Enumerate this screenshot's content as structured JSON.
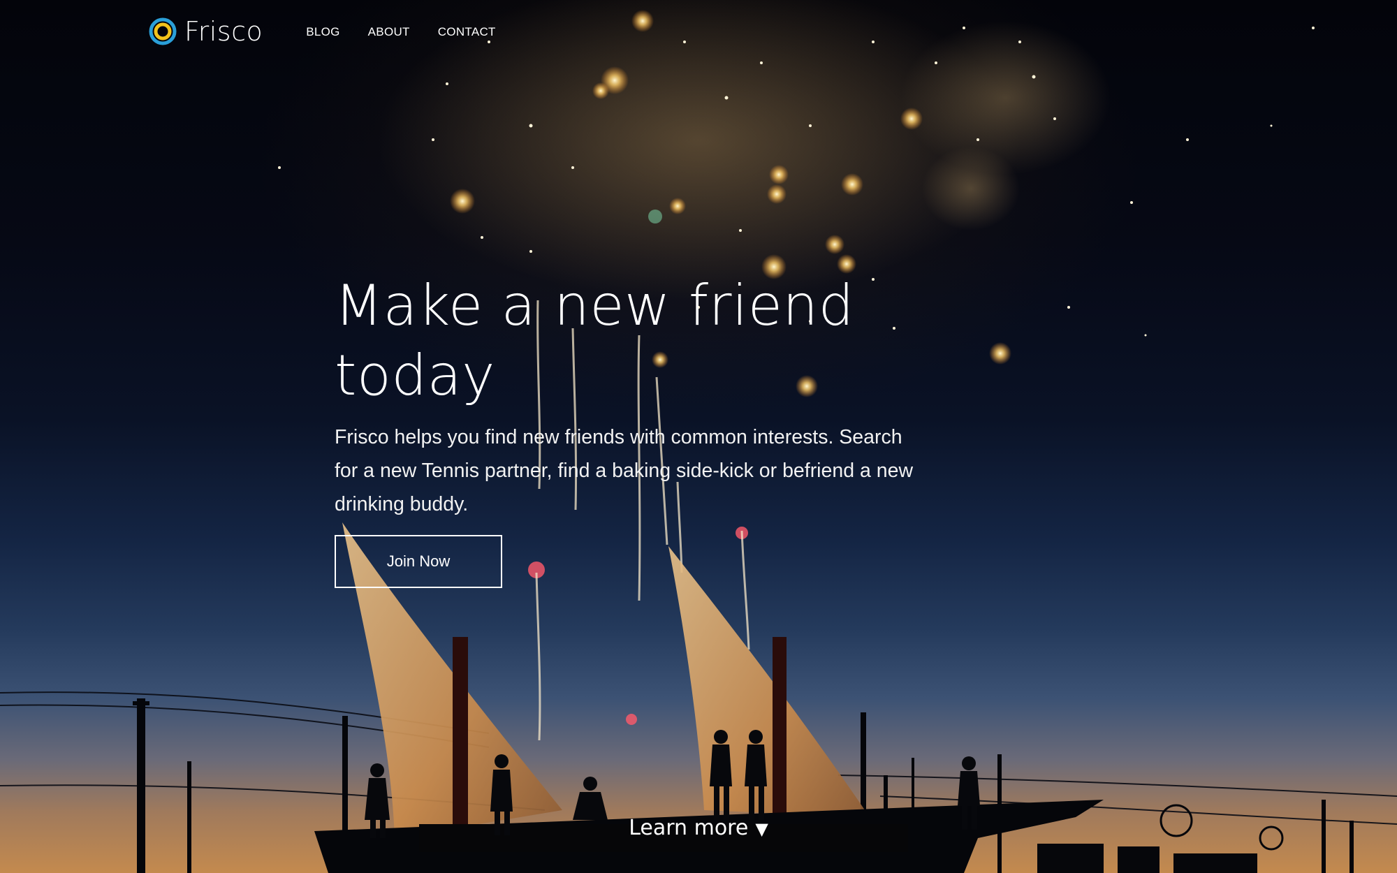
{
  "brand": {
    "name": "Frisco",
    "logo_icon": "target-ring-icon",
    "colors": {
      "ring_outer": "#2a9fd8",
      "ring_inner": "#f3c21b"
    }
  },
  "nav": {
    "items": [
      {
        "label": "BLOG"
      },
      {
        "label": "ABOUT"
      },
      {
        "label": "CONTACT"
      }
    ]
  },
  "hero": {
    "title": "Make a new friend today",
    "subtitle": "Frisco helps you find new friends with common interests. Search for a new Tennis partner, find a baking side-kick or befriend a new drinking buddy.",
    "cta_label": "Join Now",
    "background": "night-sky-fireworks-sailboat-image"
  },
  "footer_cta": {
    "label": "Learn more",
    "icon": "triangle-down-icon",
    "glyph": "▼"
  }
}
